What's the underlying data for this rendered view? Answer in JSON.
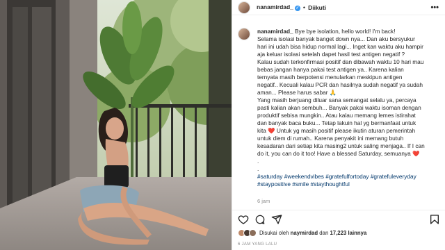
{
  "post": {
    "username": "nanamirdad_",
    "verified_mark": "✓",
    "separator": "•",
    "follow_label": "Diikuti",
    "more_icon": "more-dots-icon"
  },
  "caption": {
    "username": "nanamirdad_",
    "first_line": "Bye bye isolation, hello world! I'm back!",
    "lines": [
      "Selama isolasi banyak banget down nya... Dan aku bersyukur",
      "hari ini udah bisa hidup normal lagi... Inget kan waktu aku hampir",
      "aja keluar isolasi setelah dapet hasil test antigen negatif ?",
      "Kalau sudah terkonfirmasi positif dan dibawah waktu 10 hari mau",
      "bebas jangan hanya pakai test antigen ya.. Karena kalian",
      "ternyata masih berpotensi menularkan meskipun antigen",
      "negatif.. Kecuali kalau PCR dan hasilnya sudah negatif ya sudah",
      "aman... Please harus sabar 🙏",
      "Yang masih berjuang diluar sana semangat selalu ya, percaya",
      "pasti kalian akan sembuh... Banyak pakai waktu isoman dengan",
      "produktif sebisa mungkin.. Atau kalau memang lemes istirahat",
      "dan banyak baca buku... Tetap lakuin hal yg bermanfaat untuk",
      "kita",
      "Untuk yg masih positif please ikutin aturan pemerintah",
      "untuk diem di rumah.. Karena penyakit ini memang butuh",
      "kesadaran dari setiap kita masing2 untuk saling menjaga.. If I can",
      "do it, you can do it too! Have a blessed Saturday, semuanya",
      ".",
      "."
    ],
    "heart": "❤️",
    "tags_line1": "#saturday #weekendvibes #gratefulfortoday #gratefuleveryday",
    "tags_line2": "#staypositive #smile #staythoughtful",
    "time": "6 jam"
  },
  "likes": {
    "prefix": "Disukai oleh",
    "liker": "naymirdad",
    "connector": "dan",
    "count": "17,223",
    "suffix": "lainnya"
  },
  "posted_ago": "6 JAM YANG LALU",
  "colors": {
    "link": "#00376b",
    "heart": "#e0245e",
    "verified": "#3897f0",
    "muted": "#8e8e8e"
  }
}
